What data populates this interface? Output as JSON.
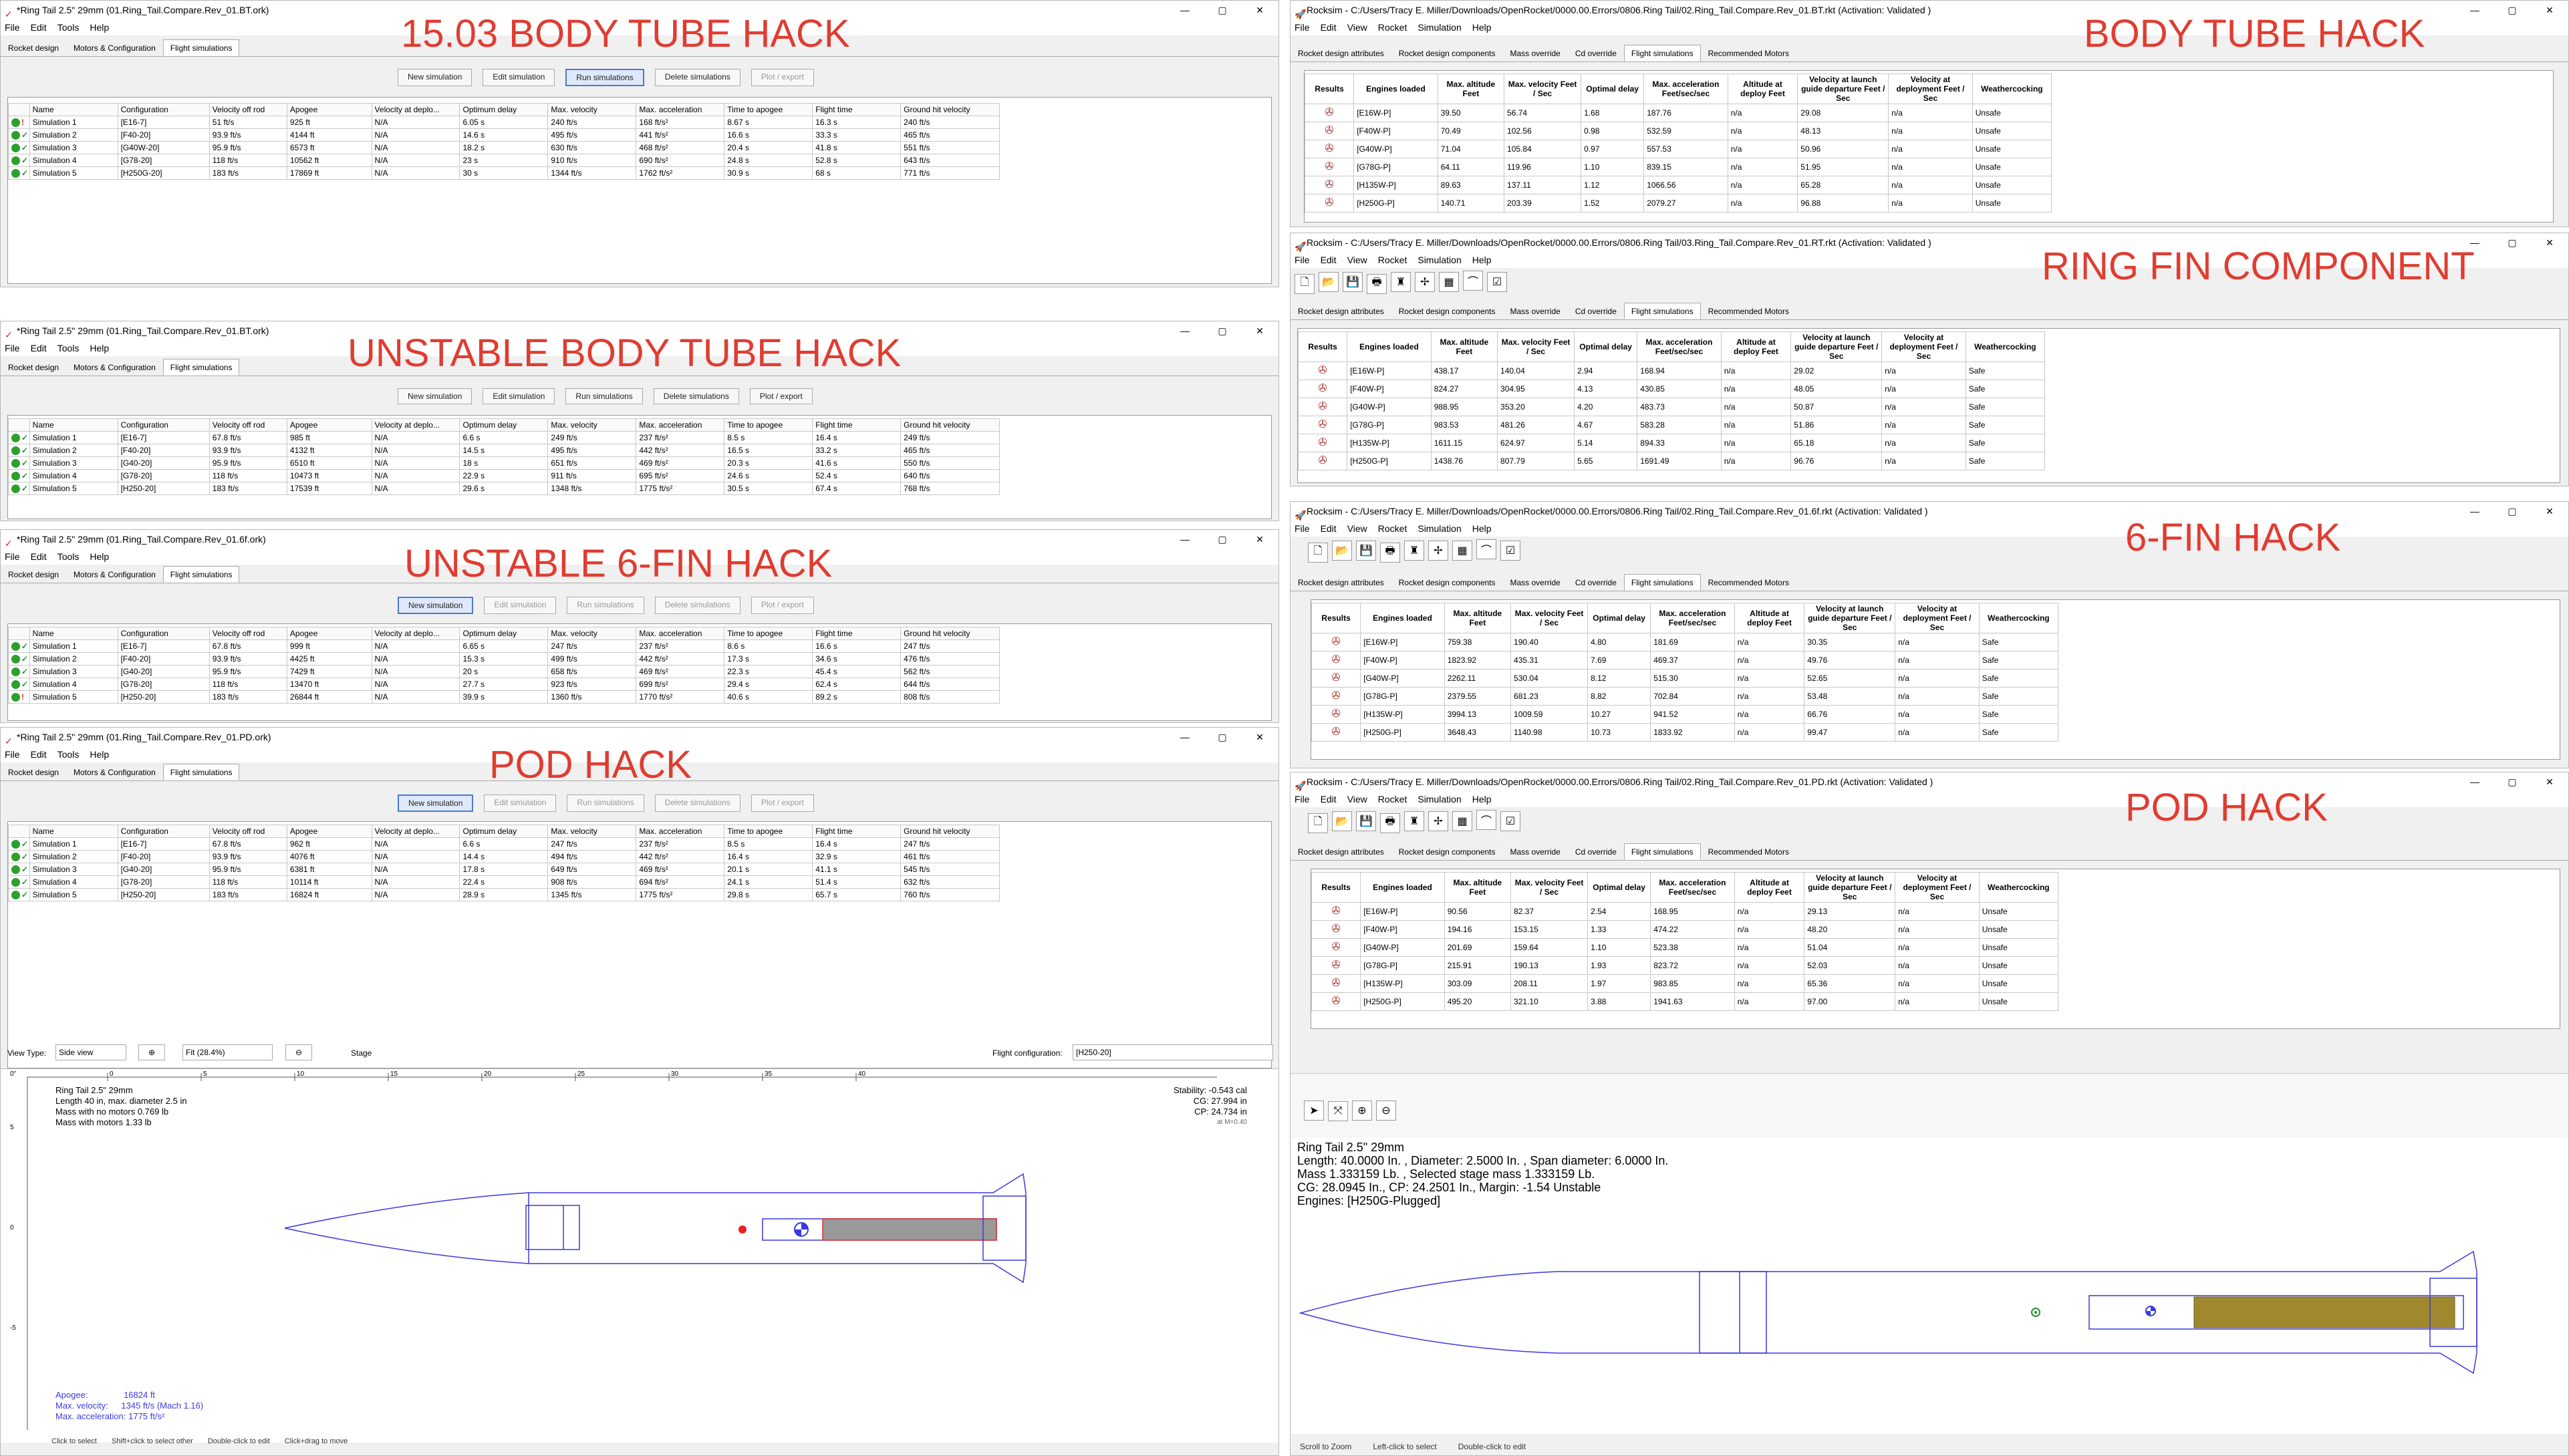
{
  "labels": {
    "l1": "15.03 BODY TUBE HACK",
    "l2": "UNSTABLE BODY TUBE HACK",
    "l3": "UNSTABLE 6-FIN HACK",
    "l4": "POD HACK",
    "r1": "BODY TUBE HACK",
    "r2": "RING FIN COMPONENT",
    "r3": "6-FIN HACK",
    "r4": "POD HACK"
  },
  "or": {
    "menu": [
      "File",
      "Edit",
      "Tools",
      "Help"
    ],
    "tabs": [
      "Rocket design",
      "Motors & Configuration",
      "Flight simulations"
    ],
    "buttons": [
      "New simulation",
      "Edit simulation",
      "Run simulations",
      "Delete simulations",
      "Plot / export"
    ],
    "cols": [
      "Name",
      "Configuration",
      "Velocity off rod",
      "Apogee",
      "Velocity at deplo...",
      "Optimum delay",
      "Max. velocity",
      "Max. acceleration",
      "Time to apogee",
      "Flight time",
      "Ground hit velocity"
    ],
    "w1": {
      "title": "*Ring Tail 2.5\" 29mm (01.Ring_Tail.Compare.Rev_01.BT.ork)",
      "rows": [
        [
          "Simulation 1",
          "[E16-7]",
          "51 ft/s",
          "925 ft",
          "N/A",
          "6.05 s",
          "240 ft/s",
          "168 ft/s²",
          "8.67 s",
          "16.3 s",
          "240 ft/s"
        ],
        [
          "Simulation 2",
          "[F40-20]",
          "93.9 ft/s",
          "4144 ft",
          "N/A",
          "14.6 s",
          "495 ft/s",
          "441 ft/s²",
          "16.6 s",
          "33.3 s",
          "465 ft/s"
        ],
        [
          "Simulation 3",
          "[G40W-20]",
          "95.9 ft/s",
          "6573 ft",
          "N/A",
          "18.2 s",
          "630 ft/s",
          "468 ft/s²",
          "20.4 s",
          "41.8 s",
          "551 ft/s"
        ],
        [
          "Simulation 4",
          "[G78-20]",
          "118 ft/s",
          "10562 ft",
          "N/A",
          "23 s",
          "910 ft/s",
          "690 ft/s²",
          "24.8 s",
          "52.8 s",
          "643 ft/s"
        ],
        [
          "Simulation 5",
          "[H250G-20]",
          "183 ft/s",
          "17869 ft",
          "N/A",
          "30 s",
          "1344 ft/s",
          "1762 ft/s²",
          "30.9 s",
          "68 s",
          "771 ft/s"
        ]
      ]
    },
    "w2": {
      "title": "*Ring Tail 2.5\" 29mm (01.Ring_Tail.Compare.Rev_01.BT.ork)",
      "rows": [
        [
          "Simulation 1",
          "[E16-7]",
          "67.8 ft/s",
          "985 ft",
          "N/A",
          "6.6 s",
          "249 ft/s",
          "237 ft/s²",
          "8.5 s",
          "16.4 s",
          "249 ft/s"
        ],
        [
          "Simulation 2",
          "[F40-20]",
          "93.9 ft/s",
          "4132 ft",
          "N/A",
          "14.5 s",
          "495 ft/s",
          "442 ft/s²",
          "16.5 s",
          "33.2 s",
          "465 ft/s"
        ],
        [
          "Simulation 3",
          "[G40-20]",
          "95.9 ft/s",
          "6510 ft",
          "N/A",
          "18 s",
          "651 ft/s",
          "469 ft/s²",
          "20.3 s",
          "41.6 s",
          "550 ft/s"
        ],
        [
          "Simulation 4",
          "[G78-20]",
          "118 ft/s",
          "10473 ft",
          "N/A",
          "22.9 s",
          "911 ft/s",
          "695 ft/s²",
          "24.6 s",
          "52.4 s",
          "640 ft/s"
        ],
        [
          "Simulation 5",
          "[H250-20]",
          "183 ft/s",
          "17539 ft",
          "N/A",
          "29.6 s",
          "1348 ft/s",
          "1775 ft/s²",
          "30.5 s",
          "67.4 s",
          "768 ft/s"
        ]
      ]
    },
    "w3": {
      "title": "*Ring Tail 2.5\" 29mm (01.Ring_Tail.Compare.Rev_01.6f.ork)",
      "rows": [
        [
          "Simulation 1",
          "[E16-7]",
          "67.8 ft/s",
          "999 ft",
          "N/A",
          "6.65 s",
          "247 ft/s",
          "237 ft/s²",
          "8.6 s",
          "16.6 s",
          "247 ft/s"
        ],
        [
          "Simulation 2",
          "[F40-20]",
          "93.9 ft/s",
          "4425 ft",
          "N/A",
          "15.3 s",
          "499 ft/s",
          "442 ft/s²",
          "17.3 s",
          "34.6 s",
          "476 ft/s"
        ],
        [
          "Simulation 3",
          "[G40-20]",
          "95.9 ft/s",
          "7429 ft",
          "N/A",
          "20 s",
          "658 ft/s",
          "469 ft/s²",
          "22.3 s",
          "45.4 s",
          "562 ft/s"
        ],
        [
          "Simulation 4",
          "[G78-20]",
          "118 ft/s",
          "13470 ft",
          "N/A",
          "27.7 s",
          "923 ft/s",
          "699 ft/s²",
          "29.4 s",
          "62.4 s",
          "644 ft/s"
        ],
        [
          "Simulation 5",
          "[H250-20]",
          "183 ft/s",
          "26844 ft",
          "N/A",
          "39.9 s",
          "1360 ft/s",
          "1770 ft/s²",
          "40.6 s",
          "89.2 s",
          "808 ft/s"
        ]
      ]
    },
    "w4": {
      "title": "*Ring Tail 2.5\" 29mm (01.Ring_Tail.Compare.Rev_01.PD.ork)",
      "rows": [
        [
          "Simulation 1",
          "[E16-7]",
          "67.8 ft/s",
          "962 ft",
          "N/A",
          "6.6 s",
          "247 ft/s",
          "237 ft/s²",
          "8.5 s",
          "16.4 s",
          "247 ft/s"
        ],
        [
          "Simulation 2",
          "[F40-20]",
          "93.9 ft/s",
          "4076 ft",
          "N/A",
          "14.4 s",
          "494 ft/s",
          "442 ft/s²",
          "16.4 s",
          "32.9 s",
          "461 ft/s"
        ],
        [
          "Simulation 3",
          "[G40-20]",
          "95.9 ft/s",
          "6381 ft",
          "N/A",
          "17.8 s",
          "649 ft/s",
          "469 ft/s²",
          "20.1 s",
          "41.1 s",
          "545 ft/s"
        ],
        [
          "Simulation 4",
          "[G78-20]",
          "118 ft/s",
          "10114 ft",
          "N/A",
          "22.4 s",
          "908 ft/s",
          "694 ft/s²",
          "24.1 s",
          "51.4 s",
          "632 ft/s"
        ],
        [
          "Simulation 5",
          "[H250-20]",
          "183 ft/s",
          "16824 ft",
          "N/A",
          "28.9 s",
          "1345 ft/s",
          "1775 ft/s²",
          "29.8 s",
          "65.7 s",
          "760 ft/s"
        ]
      ]
    },
    "view": {
      "view_type_label": "View Type:",
      "view_type": "Side view",
      "zoom": "Fit (28.4%)",
      "stage": "Stage",
      "flight_cfg_label": "Flight configuration:",
      "flight_cfg": "[H250-20]",
      "info": [
        "Ring Tail 2.5\" 29mm",
        "Length 40 in, max. diameter 2.5 in",
        "Mass with no motors 0.769 lb",
        "Mass with motors 1.33 lb"
      ],
      "stab": [
        "Stability: -0.543 cal",
        "CG:  27.994 in",
        "CP:  24.734 in",
        "at M=0.40"
      ],
      "flight": [
        "Apogee:",
        "16824 ft",
        "Max. velocity:",
        "1345 ft/s  (Mach 1.16)",
        "Max. acceleration: 1775 ft/s²"
      ],
      "ruler": [
        "0",
        "5",
        "10",
        "15",
        "20",
        "25",
        "30",
        "35",
        "40"
      ],
      "vruler": [
        "0\"",
        "5",
        "0",
        "-5"
      ],
      "status": [
        "Click to select",
        "Shift+click to select other",
        "Double-click to edit",
        "Click+drag to move"
      ]
    }
  },
  "rs": {
    "menu": [
      "File",
      "Edit",
      "View",
      "Rocket",
      "Simulation",
      "Help"
    ],
    "tabs": [
      "Rocket design attributes",
      "Rocket design components",
      "Mass override",
      "Cd override",
      "Flight simulations",
      "Recommended Motors"
    ],
    "cols": [
      "Results",
      "Engines loaded",
      "Max. altitude Feet",
      "Max. velocity Feet / Sec",
      "Optimal delay",
      "Max. acceleration Feet/sec/sec",
      "Altitude at deploy Feet",
      "Velocity at launch guide departure Feet / Sec",
      "Velocity at deployment Feet / Sec",
      "Weathercocking"
    ],
    "w1": {
      "title": "Rocksim - C:/Users/Tracy E. Miller/Downloads/OpenRocket/0000.00.Errors/0806.Ring Tail/02.Ring_Tail.Compare.Rev_01.BT.rkt  (Activation: Validated )",
      "rows": [
        [
          "[E16W-P]",
          "39.50",
          "56.74",
          "1.68",
          "187.76",
          "n/a",
          "29.08",
          "n/a",
          "Unsafe"
        ],
        [
          "[F40W-P]",
          "70.49",
          "102.56",
          "0.98",
          "532.59",
          "n/a",
          "48.13",
          "n/a",
          "Unsafe"
        ],
        [
          "[G40W-P]",
          "71.04",
          "105.84",
          "0.97",
          "557.53",
          "n/a",
          "50.96",
          "n/a",
          "Unsafe"
        ],
        [
          "[G78G-P]",
          "64.11",
          "119.96",
          "1.10",
          "839.15",
          "n/a",
          "51.95",
          "n/a",
          "Unsafe"
        ],
        [
          "[H135W-P]",
          "89.63",
          "137.11",
          "1.12",
          "1066.56",
          "n/a",
          "65.28",
          "n/a",
          "Unsafe"
        ],
        [
          "[H250G-P]",
          "140.71",
          "203.39",
          "1.52",
          "2079.27",
          "n/a",
          "96.88",
          "n/a",
          "Unsafe"
        ]
      ]
    },
    "w2": {
      "title": "Rocksim - C:/Users/Tracy E. Miller/Downloads/OpenRocket/0000.00.Errors/0806.Ring Tail/03.Ring_Tail.Compare.Rev_01.RT.rkt  (Activation: Validated )",
      "rows": [
        [
          "[E16W-P]",
          "438.17",
          "140.04",
          "2.94",
          "168.94",
          "n/a",
          "29.02",
          "n/a",
          "Safe"
        ],
        [
          "[F40W-P]",
          "824.27",
          "304.95",
          "4.13",
          "430.85",
          "n/a",
          "48.05",
          "n/a",
          "Safe"
        ],
        [
          "[G40W-P]",
          "988.95",
          "353.20",
          "4.20",
          "483.73",
          "n/a",
          "50.87",
          "n/a",
          "Safe"
        ],
        [
          "[G78G-P]",
          "983.53",
          "481.26",
          "4.67",
          "583.28",
          "n/a",
          "51.86",
          "n/a",
          "Safe"
        ],
        [
          "[H135W-P]",
          "1611.15",
          "624.97",
          "5.14",
          "894.33",
          "n/a",
          "65.18",
          "n/a",
          "Safe"
        ],
        [
          "[H250G-P]",
          "1438.76",
          "807.79",
          "5.65",
          "1691.49",
          "n/a",
          "96.76",
          "n/a",
          "Safe"
        ]
      ]
    },
    "w3": {
      "title": "Rocksim - C:/Users/Tracy E. Miller/Downloads/OpenRocket/0000.00.Errors/0806.Ring Tail/02.Ring_Tail.Compare.Rev_01.6f.rkt  (Activation: Validated )",
      "rows": [
        [
          "[E16W-P]",
          "759.38",
          "190.40",
          "4.80",
          "181.69",
          "n/a",
          "30.35",
          "n/a",
          "Safe"
        ],
        [
          "[F40W-P]",
          "1823.92",
          "435.31",
          "7.69",
          "469.37",
          "n/a",
          "49.76",
          "n/a",
          "Safe"
        ],
        [
          "[G40W-P]",
          "2262.11",
          "530.04",
          "8.12",
          "515.30",
          "n/a",
          "52.65",
          "n/a",
          "Safe"
        ],
        [
          "[G78G-P]",
          "2379.55",
          "681.23",
          "8.82",
          "702.84",
          "n/a",
          "53.48",
          "n/a",
          "Safe"
        ],
        [
          "[H135W-P]",
          "3994.13",
          "1009.59",
          "10.27",
          "941.52",
          "n/a",
          "66.76",
          "n/a",
          "Safe"
        ],
        [
          "[H250G-P]",
          "3648.43",
          "1140.98",
          "10.73",
          "1833.92",
          "n/a",
          "99.47",
          "n/a",
          "Safe"
        ]
      ]
    },
    "w4": {
      "title": "Rocksim - C:/Users/Tracy E. Miller/Downloads/OpenRocket/0000.00.Errors/0806.Ring Tail/02.Ring_Tail.Compare.Rev_01.PD.rkt  (Activation: Validated )",
      "rows": [
        [
          "[E16W-P]",
          "90.56",
          "82.37",
          "2.54",
          "168.95",
          "n/a",
          "29.13",
          "n/a",
          "Unsafe"
        ],
        [
          "[F40W-P]",
          "194.16",
          "153.15",
          "1.33",
          "474.22",
          "n/a",
          "48.20",
          "n/a",
          "Unsafe"
        ],
        [
          "[G40W-P]",
          "201.69",
          "159.64",
          "1.10",
          "523.38",
          "n/a",
          "51.04",
          "n/a",
          "Unsafe"
        ],
        [
          "[G78G-P]",
          "215.91",
          "190.13",
          "1.93",
          "823.72",
          "n/a",
          "52.03",
          "n/a",
          "Unsafe"
        ],
        [
          "[H135W-P]",
          "303.09",
          "208.11",
          "1.97",
          "983.85",
          "n/a",
          "65.36",
          "n/a",
          "Unsafe"
        ],
        [
          "[H250G-P]",
          "495.20",
          "321.10",
          "3.88",
          "1941.63",
          "n/a",
          "97.00",
          "n/a",
          "Unsafe"
        ]
      ]
    },
    "view": {
      "info": [
        "Ring Tail 2.5\" 29mm",
        "Length: 40.0000  In. , Diameter: 2.5000  In. , Span diameter: 6.0000  In.",
        "Mass 1.333159 Lb. , Selected stage mass 1.333159 Lb.",
        "CG: 28.0945 In., CP: 24.2501 In., Margin: -1.54 Unstable",
        "Engines: [H250G-Plugged]"
      ],
      "status": [
        "Scroll to Zoom",
        "Left-click to select",
        "Double-click to edit"
      ]
    }
  }
}
